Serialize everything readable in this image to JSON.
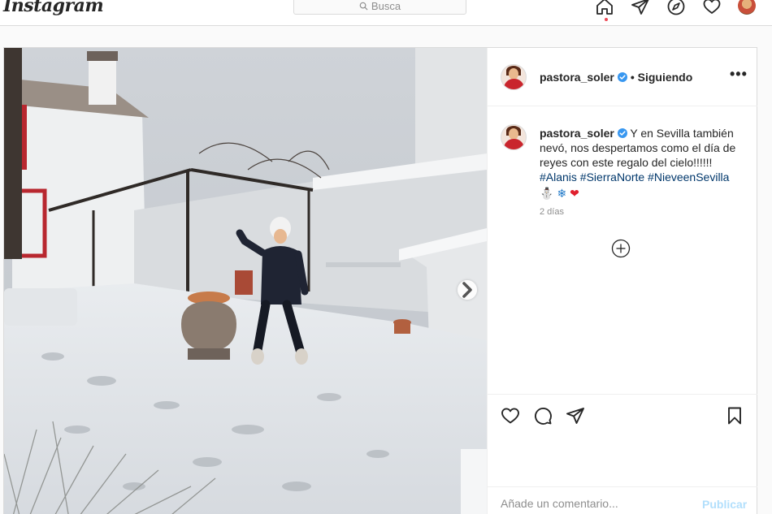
{
  "topbar": {
    "logo": "Instagram",
    "search_placeholder": "Busca",
    "icons": [
      "home-icon",
      "direct-icon",
      "explore-icon",
      "activity-icon",
      "profile-avatar"
    ]
  },
  "post": {
    "author": "pastora_soler",
    "follow_status": "• Siguiendo",
    "more_label": "•••",
    "caption_text": "Y en Sevilla también nevó, nos despertamos como el día de reyes con este regalo del cielo!!!!!!",
    "hashtags": "#Alanis #SierraNorte #NieveenSevilla",
    "emojis": [
      "⛄",
      "❄",
      "❤"
    ],
    "time_ago": "2 días",
    "comment_placeholder": "Añade un comentario...",
    "publish_label": "Publicar"
  },
  "colors": {
    "link": "#00376b",
    "verified": "#3897f0",
    "notification_dot": "#ed4956",
    "publish_disabled": "#b2dffc"
  }
}
